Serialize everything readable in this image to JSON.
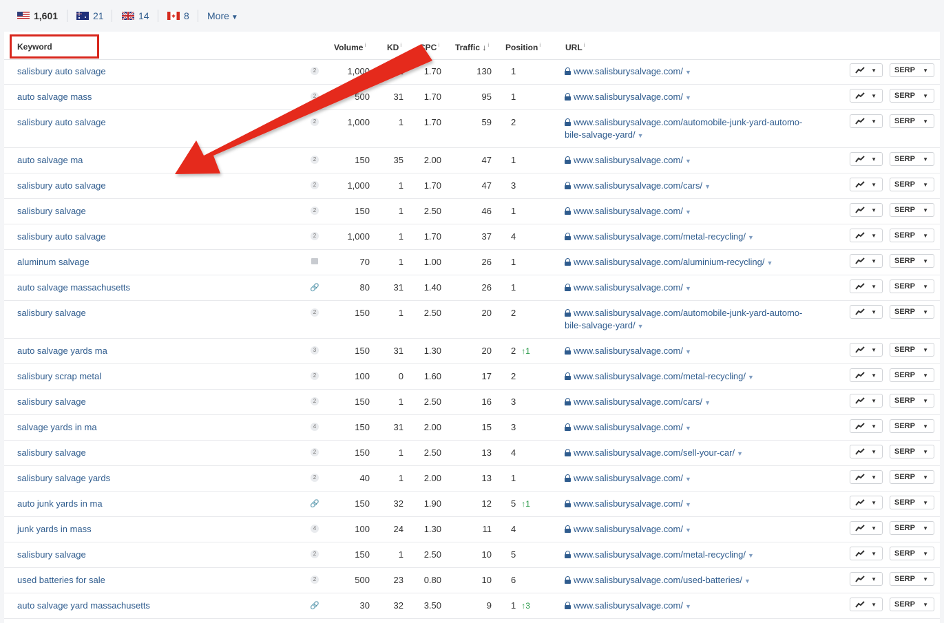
{
  "countries": [
    {
      "code": "US",
      "count": "1,601",
      "active": true
    },
    {
      "code": "AU",
      "count": "21"
    },
    {
      "code": "GB",
      "count": "14"
    },
    {
      "code": "CA",
      "count": "8"
    }
  ],
  "more_label": "More",
  "columns": {
    "keyword": "Keyword",
    "volume": "Volume",
    "kd": "KD",
    "cpc": "CPC",
    "traffic": "Traffic",
    "position": "Position",
    "url": "URL"
  },
  "column_info_mark": "i",
  "traffic_sort_indicator": "↓",
  "serp_label": "SERP",
  "colors": {
    "link": "#2f5c8e",
    "highlight": "#d8261c",
    "arrow": "#e52a1f",
    "up": "#2b9a4a"
  },
  "rows": [
    {
      "keyword": "salisbury auto salvage",
      "sf": "2",
      "volume": "1,000",
      "kd": "1",
      "cpc": "1.70",
      "traffic": "130",
      "position": "1",
      "change": "",
      "url": [
        "www.salisburysalvage.com/"
      ]
    },
    {
      "keyword": "auto salvage mass",
      "sf": "2",
      "volume": "500",
      "kd": "31",
      "cpc": "1.70",
      "traffic": "95",
      "position": "1",
      "change": "",
      "url": [
        "www.salisburysalvage.com/"
      ]
    },
    {
      "keyword": "salisbury auto salvage",
      "sf": "2",
      "volume": "1,000",
      "kd": "1",
      "cpc": "1.70",
      "traffic": "59",
      "position": "2",
      "change": "",
      "url": [
        "www.salisburysalvage.com/automobile-junk-yard-automo-",
        "bile-salvage-yard/"
      ]
    },
    {
      "keyword": "auto salvage ma",
      "sf": "2",
      "volume": "150",
      "kd": "35",
      "cpc": "2.00",
      "traffic": "47",
      "position": "1",
      "change": "",
      "url": [
        "www.salisburysalvage.com/"
      ]
    },
    {
      "keyword": "salisbury auto salvage",
      "sf": "2",
      "volume": "1,000",
      "kd": "1",
      "cpc": "1.70",
      "traffic": "47",
      "position": "3",
      "change": "",
      "url": [
        "www.salisburysalvage.com/cars/"
      ]
    },
    {
      "keyword": "salisbury salvage",
      "sf": "2",
      "volume": "150",
      "kd": "1",
      "cpc": "2.50",
      "traffic": "46",
      "position": "1",
      "change": "",
      "url": [
        "www.salisburysalvage.com/"
      ]
    },
    {
      "keyword": "salisbury auto salvage",
      "sf": "2",
      "volume": "1,000",
      "kd": "1",
      "cpc": "1.70",
      "traffic": "37",
      "position": "4",
      "change": "",
      "url": [
        "www.salisburysalvage.com/metal-recycling/"
      ]
    },
    {
      "keyword": "aluminum salvage",
      "sf": "image",
      "volume": "70",
      "kd": "1",
      "cpc": "1.00",
      "traffic": "26",
      "position": "1",
      "change": "",
      "url": [
        "www.salisburysalvage.com/aluminium-recycling/"
      ]
    },
    {
      "keyword": "auto salvage massachusetts",
      "sf": "link",
      "volume": "80",
      "kd": "31",
      "cpc": "1.40",
      "traffic": "26",
      "position": "1",
      "change": "",
      "url": [
        "www.salisburysalvage.com/"
      ]
    },
    {
      "keyword": "salisbury salvage",
      "sf": "2",
      "volume": "150",
      "kd": "1",
      "cpc": "2.50",
      "traffic": "20",
      "position": "2",
      "change": "",
      "url": [
        "www.salisburysalvage.com/automobile-junk-yard-automo-",
        "bile-salvage-yard/"
      ]
    },
    {
      "keyword": "auto salvage yards ma",
      "sf": "3",
      "volume": "150",
      "kd": "31",
      "cpc": "1.30",
      "traffic": "20",
      "position": "2",
      "change": "↑1",
      "url": [
        "www.salisburysalvage.com/"
      ]
    },
    {
      "keyword": "salisbury scrap metal",
      "sf": "2",
      "volume": "100",
      "kd": "0",
      "cpc": "1.60",
      "traffic": "17",
      "position": "2",
      "change": "",
      "url": [
        "www.salisburysalvage.com/metal-recycling/"
      ]
    },
    {
      "keyword": "salisbury salvage",
      "sf": "2",
      "volume": "150",
      "kd": "1",
      "cpc": "2.50",
      "traffic": "16",
      "position": "3",
      "change": "",
      "url": [
        "www.salisburysalvage.com/cars/"
      ]
    },
    {
      "keyword": "salvage yards in ma",
      "sf": "4",
      "volume": "150",
      "kd": "31",
      "cpc": "2.00",
      "traffic": "15",
      "position": "3",
      "change": "",
      "url": [
        "www.salisburysalvage.com/"
      ]
    },
    {
      "keyword": "salisbury salvage",
      "sf": "2",
      "volume": "150",
      "kd": "1",
      "cpc": "2.50",
      "traffic": "13",
      "position": "4",
      "change": "",
      "url": [
        "www.salisburysalvage.com/sell-your-car/"
      ]
    },
    {
      "keyword": "salisbury salvage yards",
      "sf": "2",
      "volume": "40",
      "kd": "1",
      "cpc": "2.00",
      "traffic": "13",
      "position": "1",
      "change": "",
      "url": [
        "www.salisburysalvage.com/"
      ]
    },
    {
      "keyword": "auto junk yards in ma",
      "sf": "link",
      "volume": "150",
      "kd": "32",
      "cpc": "1.90",
      "traffic": "12",
      "position": "5",
      "change": "↑1",
      "url": [
        "www.salisburysalvage.com/"
      ]
    },
    {
      "keyword": "junk yards in mass",
      "sf": "4",
      "volume": "100",
      "kd": "24",
      "cpc": "1.30",
      "traffic": "11",
      "position": "4",
      "change": "",
      "url": [
        "www.salisburysalvage.com/"
      ]
    },
    {
      "keyword": "salisbury salvage",
      "sf": "2",
      "volume": "150",
      "kd": "1",
      "cpc": "2.50",
      "traffic": "10",
      "position": "5",
      "change": "",
      "url": [
        "www.salisburysalvage.com/metal-recycling/"
      ]
    },
    {
      "keyword": "used batteries for sale",
      "sf": "2",
      "volume": "500",
      "kd": "23",
      "cpc": "0.80",
      "traffic": "10",
      "position": "6",
      "change": "",
      "url": [
        "www.salisburysalvage.com/used-batteries/"
      ]
    },
    {
      "keyword": "auto salvage yard massachusetts",
      "sf": "link",
      "volume": "30",
      "kd": "32",
      "cpc": "3.50",
      "traffic": "9",
      "position": "1",
      "change": "↑3",
      "url": [
        "www.salisburysalvage.com/"
      ]
    }
  ]
}
